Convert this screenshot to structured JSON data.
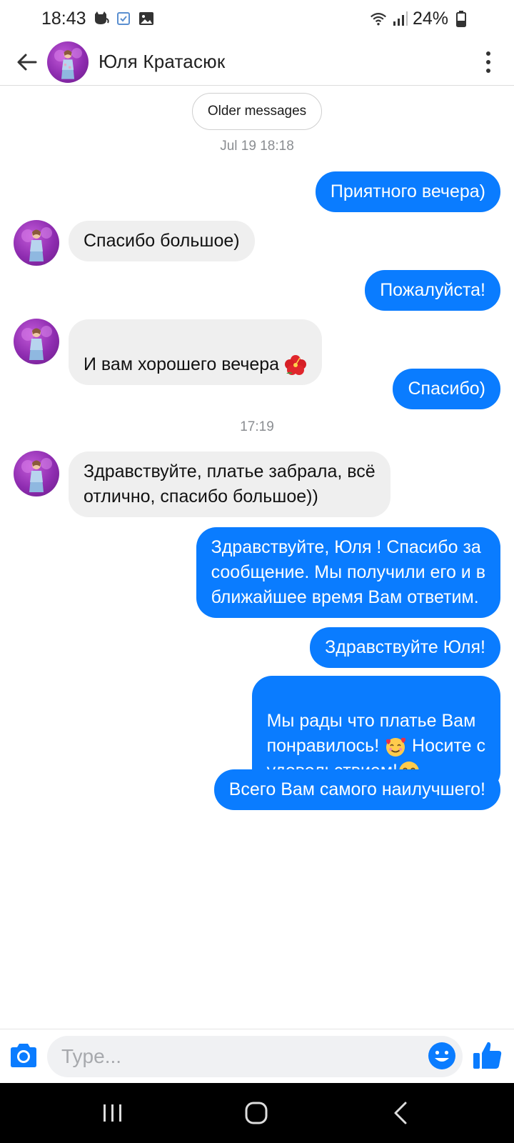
{
  "status_bar": {
    "time": "18:43",
    "battery": "24%",
    "icons": [
      "cat-notification-icon",
      "checkbox-notification-icon",
      "image-notification-icon",
      "wifi-icon",
      "signal-icon",
      "battery-icon"
    ]
  },
  "header": {
    "contact_name": "Юля Кратасюк",
    "icons": [
      "back-arrow-icon",
      "more-vert-icon"
    ]
  },
  "conversation": {
    "older_messages_label": "Older messages",
    "separators": [
      "Jul 19 18:18",
      "17:19"
    ],
    "messages": [
      {
        "direction": "out",
        "text": "Приятного вечера)"
      },
      {
        "direction": "in",
        "text": "Спасибо большое)"
      },
      {
        "direction": "out",
        "text": "Пожалуйста!"
      },
      {
        "direction": "in",
        "text": "И вам хорошего вечера ",
        "emoji": "hibiscus"
      },
      {
        "direction": "out",
        "text": "Спасибо)"
      },
      {
        "direction": "in",
        "text": "Здравствуйте, платье забрала, всё\nотлично, спасибо большое))"
      },
      {
        "direction": "out",
        "text": "Здравствуйте, Юля ! Спасибо за\nсообщение. Мы получили его и в\nближайшее время  Вам ответим."
      },
      {
        "direction": "out",
        "text": "Здравствуйте Юля!"
      },
      {
        "direction": "out",
        "text_1": "Мы рады что платье Вам\nпонравилось!  ",
        "emoji_1": "smiling-face-with-hearts",
        "text_2": " Носите с\nудовольствием!",
        "emoji_2": "smiling-face"
      },
      {
        "direction": "out",
        "text": "Всего Вам самого наилучшего!"
      }
    ]
  },
  "composer": {
    "placeholder": "Type...",
    "icons": [
      "camera-icon",
      "emoji-icon",
      "thumbs-up-icon"
    ]
  },
  "colors": {
    "outgoing_bubble": "#0a7cff",
    "incoming_bubble": "#efefef",
    "accent": "#0a7cff"
  }
}
